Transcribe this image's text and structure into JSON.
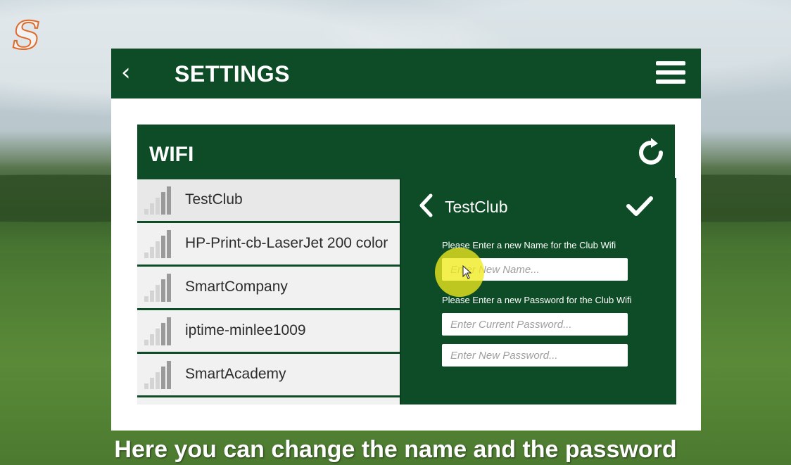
{
  "app": {
    "logo_letter": "S"
  },
  "header": {
    "back_icon": "chevron-left-icon",
    "title": "SETTINGS",
    "menu_icon": "hamburger-menu-icon"
  },
  "wifi": {
    "title": "WIFI",
    "refresh_icon": "refresh-icon",
    "networks": [
      {
        "name": "TestClub",
        "selected": true
      },
      {
        "name": "HP-Print-cb-LaserJet 200 color"
      },
      {
        "name": "SmartCompany"
      },
      {
        "name": "iptime-minlee1009"
      },
      {
        "name": "SmartAcademy"
      }
    ]
  },
  "detail": {
    "back_icon": "chevron-left-icon",
    "network_name": "TestClub",
    "confirm_icon": "checkmark-icon",
    "name_label": "Please Enter a new Name for the Club Wifi",
    "name_placeholder": "Enter New Name...",
    "password_label": "Please Enter a new Password for the Club Wifi",
    "current_password_placeholder": "Enter Current Password...",
    "new_password_placeholder": "Enter New Password..."
  },
  "caption": "Here you can change the name and the password",
  "colors": {
    "primary_green": "#0d4c26",
    "highlight": "#f0eb1e",
    "logo_orange": "#e06a2a"
  }
}
